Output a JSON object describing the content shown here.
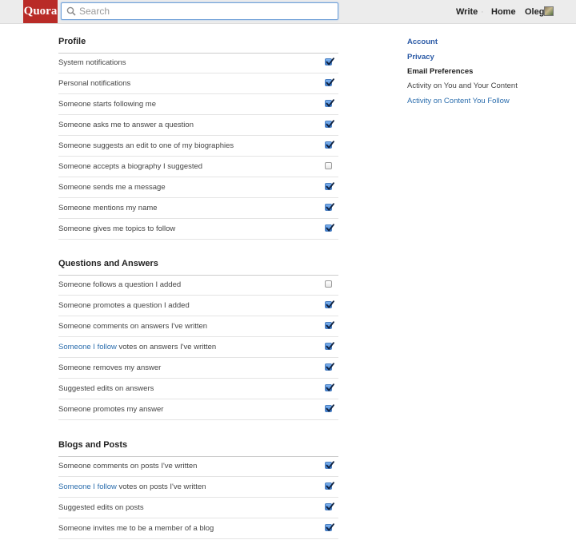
{
  "header": {
    "logo": "Quora",
    "search_placeholder": "Search",
    "nav": {
      "write": "Write",
      "home": "Home",
      "user": "Oleg"
    }
  },
  "sections": [
    {
      "title": "Profile",
      "rows": [
        {
          "text": "System notifications",
          "checked": true
        },
        {
          "text": "Personal notifications",
          "checked": true
        },
        {
          "text": "Someone starts following me",
          "checked": true
        },
        {
          "text": "Someone asks me to answer a question",
          "checked": true
        },
        {
          "text": "Someone suggests an edit to one of my biographies",
          "checked": true
        },
        {
          "text": "Someone accepts a biography I suggested",
          "checked": false
        },
        {
          "text": "Someone sends me a message",
          "checked": true
        },
        {
          "text": "Someone mentions my name",
          "checked": true
        },
        {
          "text": "Someone gives me topics to follow",
          "checked": true
        }
      ]
    },
    {
      "title": "Questions and Answers",
      "rows": [
        {
          "text": "Someone follows a question I added",
          "checked": false
        },
        {
          "text": "Someone promotes a question I added",
          "checked": true
        },
        {
          "text": "Someone comments on answers I've written",
          "checked": true
        },
        {
          "link": "Someone I follow",
          "text": " votes on answers I've written",
          "checked": true
        },
        {
          "text": "Someone removes my answer",
          "checked": true
        },
        {
          "text": "Suggested edits on answers",
          "checked": true
        },
        {
          "text": "Someone promotes my answer",
          "checked": true
        }
      ]
    },
    {
      "title": "Blogs and Posts",
      "rows": [
        {
          "text": "Someone comments on posts I've written",
          "checked": true
        },
        {
          "link": "Someone I follow",
          "text": " votes on posts I've written",
          "checked": true
        },
        {
          "text": "Suggested edits on posts",
          "checked": true
        },
        {
          "text": "Someone invites me to be a member of a blog",
          "checked": true
        }
      ]
    }
  ],
  "sidebar": {
    "items": [
      {
        "label": "Account",
        "style": "link-bold"
      },
      {
        "label": "Privacy",
        "style": "link-bold"
      },
      {
        "label": "Email Preferences",
        "style": "current"
      },
      {
        "label": "Activity on You and Your Content",
        "style": "plain"
      },
      {
        "label": "Activity on Content You Follow",
        "style": "link"
      }
    ]
  },
  "colors": {
    "brand": "#b92b27",
    "link": "#2b6dad",
    "checkbox_checked": "#3d7cd0"
  }
}
